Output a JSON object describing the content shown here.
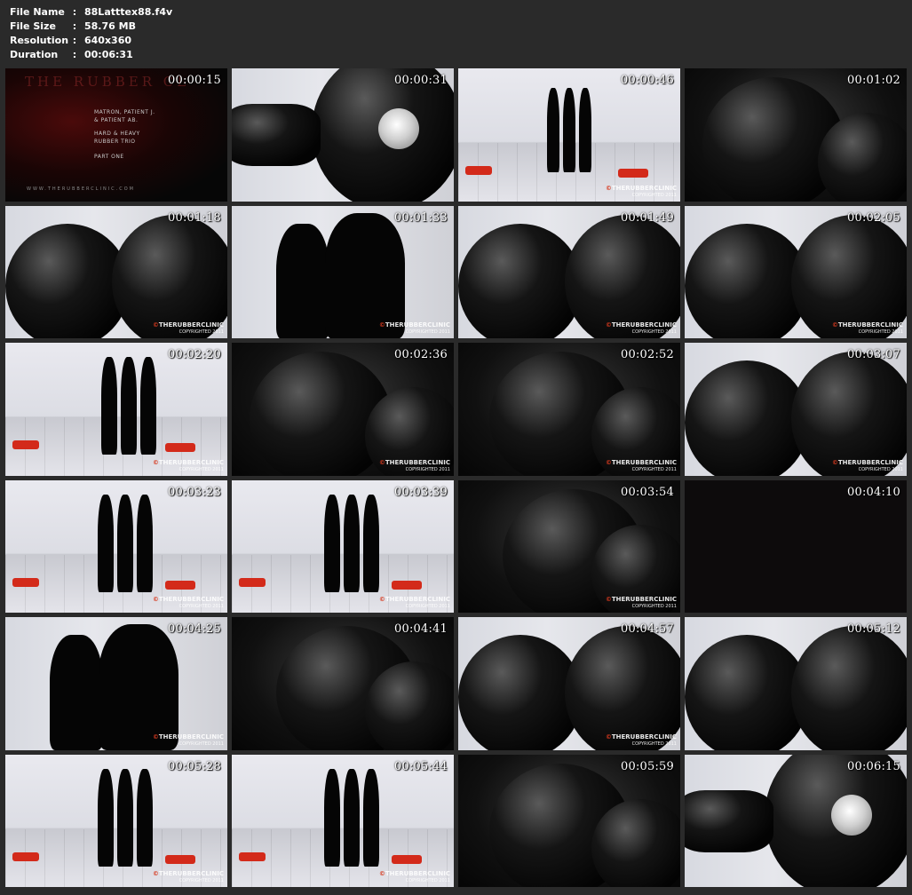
{
  "file_info": {
    "file_name_label": "File Name",
    "file_name": "88Latttex88.f4v",
    "file_size_label": "File Size",
    "file_size": "58.76 MB",
    "resolution_label": "Resolution",
    "resolution": "640x360",
    "duration_label": "Duration",
    "duration": "00:06:31",
    "separator": ":"
  },
  "watermark": {
    "brand": "THERUBBERCLINIC",
    "copyright": "COPYRIGHTED 2011",
    "symbol": "©"
  },
  "title_card": {
    "title": "THE RUBBER CL",
    "line1": "MATRON, PATIENT J.",
    "line2": "& PATIENT AB.",
    "line3": "HARD & HEAVY",
    "line4": "RUBBER TRIO",
    "line5": "PART ONE",
    "url": "WWW.THERUBBERCLINIC.COM"
  },
  "thumbnails": [
    {
      "timestamp": "00:00:15",
      "scene": "title",
      "watermark": false
    },
    {
      "timestamp": "00:00:31",
      "scene": "close-mask",
      "watermark": false
    },
    {
      "timestamp": "00:00:46",
      "scene": "room-trio-small",
      "watermark": true
    },
    {
      "timestamp": "00:01:02",
      "scene": "dark-close",
      "watermark": false
    },
    {
      "timestamp": "00:01:18",
      "scene": "wall-close",
      "watermark": true
    },
    {
      "timestamp": "00:01:33",
      "scene": "wall-pair",
      "watermark": true
    },
    {
      "timestamp": "00:01:49",
      "scene": "wall-close",
      "watermark": true
    },
    {
      "timestamp": "00:02:05",
      "scene": "wall-close",
      "watermark": true
    },
    {
      "timestamp": "00:02:20",
      "scene": "room-wide",
      "watermark": true
    },
    {
      "timestamp": "00:02:36",
      "scene": "dark-close",
      "watermark": true
    },
    {
      "timestamp": "00:02:52",
      "scene": "dark-close",
      "watermark": true
    },
    {
      "timestamp": "00:03:07",
      "scene": "wall-close",
      "watermark": true
    },
    {
      "timestamp": "00:03:23",
      "scene": "room-trio",
      "watermark": true
    },
    {
      "timestamp": "00:03:39",
      "scene": "room-trio",
      "watermark": true
    },
    {
      "timestamp": "00:03:54",
      "scene": "dark-close",
      "watermark": true
    },
    {
      "timestamp": "00:04:10",
      "scene": "black",
      "watermark": false
    },
    {
      "timestamp": "00:04:25",
      "scene": "wall-pair",
      "watermark": true
    },
    {
      "timestamp": "00:04:41",
      "scene": "dark-close",
      "watermark": false
    },
    {
      "timestamp": "00:04:57",
      "scene": "wall-close",
      "watermark": true
    },
    {
      "timestamp": "00:05:12",
      "scene": "wall-close",
      "watermark": false
    },
    {
      "timestamp": "00:05:28",
      "scene": "room-trio",
      "watermark": true
    },
    {
      "timestamp": "00:05:44",
      "scene": "room-trio",
      "watermark": true
    },
    {
      "timestamp": "00:05:59",
      "scene": "dark-close",
      "watermark": false
    },
    {
      "timestamp": "00:06:15",
      "scene": "close-mask",
      "watermark": false
    }
  ],
  "colors": {
    "background": "#2a2a2a",
    "text": "#ffffff",
    "watermark_accent": "#d83a1f",
    "pad_red": "#d32a1a"
  }
}
